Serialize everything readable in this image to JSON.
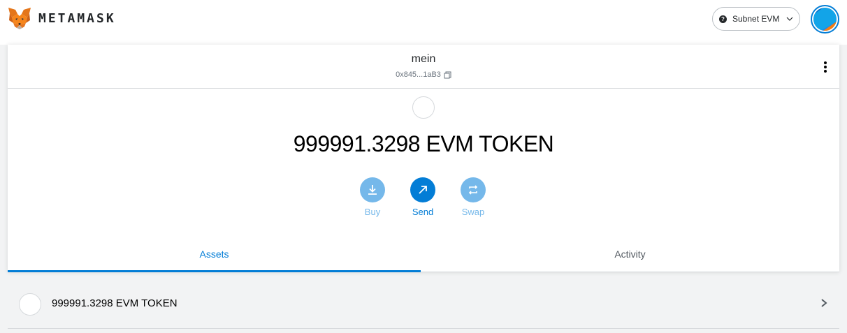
{
  "brand": {
    "wordmark": "METAMASK"
  },
  "network": {
    "label": "Subnet EVM",
    "icon": "question-mark-dot",
    "icon_glyph": "?"
  },
  "account": {
    "name": "mein",
    "address": "0x845...1aB3",
    "menu_icon": "kebab-menu-icon"
  },
  "balance": {
    "text": "999991.3298 EVM TOKEN"
  },
  "actions": {
    "buy": "Buy",
    "send": "Send",
    "swap": "Swap"
  },
  "tabs": {
    "assets": "Assets",
    "activity": "Activity",
    "active": "assets"
  },
  "assets": [
    {
      "label": "999991.3298 EVM TOKEN"
    }
  ],
  "colors": {
    "accent": "#037dd6",
    "accent_light": "#75b8ea",
    "fox_orange": "#e2761b",
    "background": "#f2f3f4"
  }
}
